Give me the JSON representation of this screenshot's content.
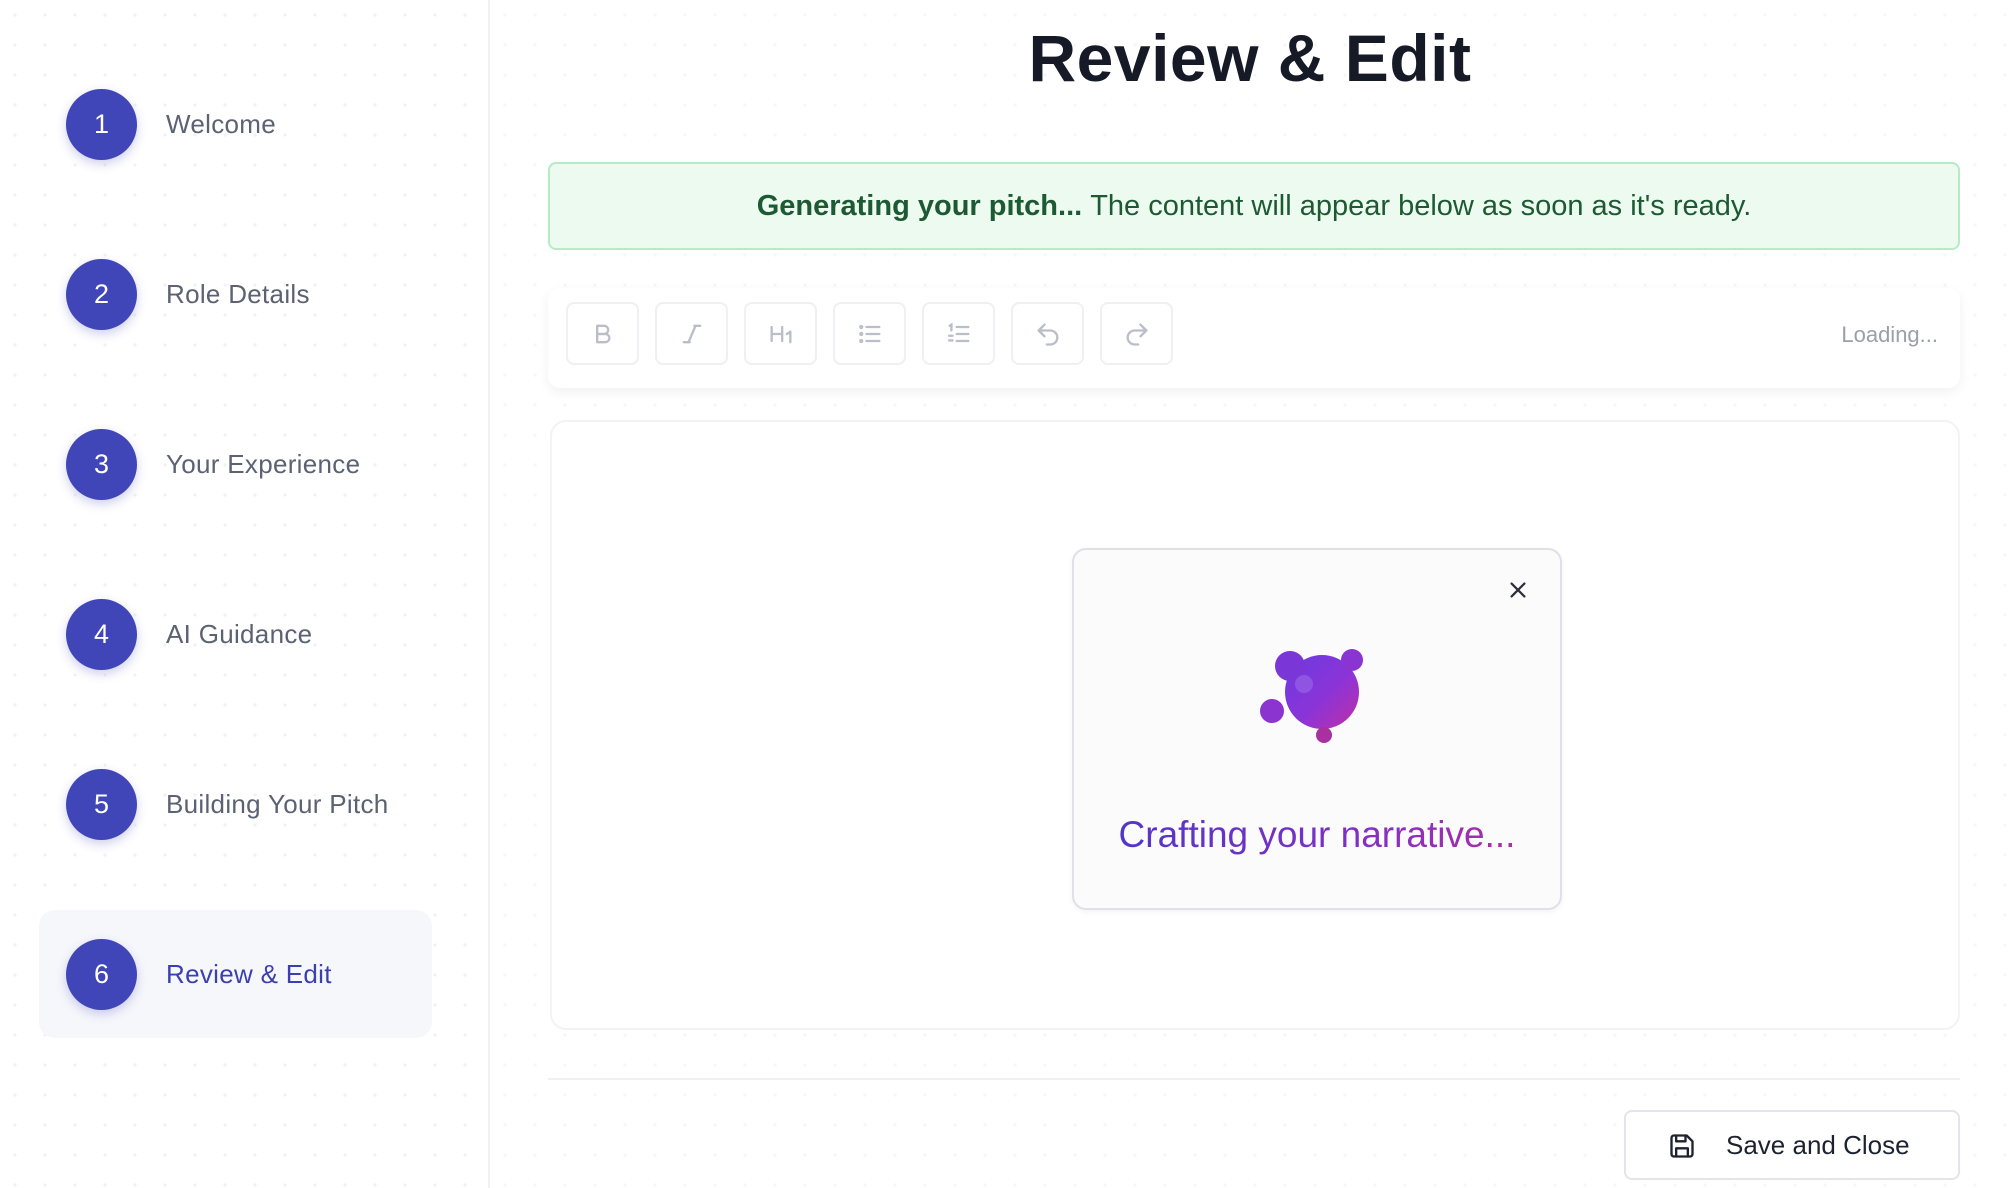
{
  "sidebar": {
    "steps": [
      {
        "number": "1",
        "label": "Welcome"
      },
      {
        "number": "2",
        "label": "Role Details"
      },
      {
        "number": "3",
        "label": "Your Experience"
      },
      {
        "number": "4",
        "label": "AI Guidance"
      },
      {
        "number": "5",
        "label": "Building Your Pitch"
      },
      {
        "number": "6",
        "label": "Review & Edit",
        "active": true
      }
    ]
  },
  "main": {
    "title": "Review & Edit",
    "banner": {
      "strong": "Generating your pitch...",
      "text": "The content will appear below as soon as it's ready."
    },
    "toolbar": {
      "buttons": [
        {
          "icon": "bold-icon",
          "label": "B"
        },
        {
          "icon": "italic-icon",
          "label": "I"
        },
        {
          "icon": "heading-1-icon",
          "label": "H1"
        },
        {
          "icon": "bullet-list-icon"
        },
        {
          "icon": "numbered-list-icon"
        },
        {
          "icon": "undo-icon"
        },
        {
          "icon": "redo-icon"
        }
      ],
      "status": "Loading..."
    },
    "loading_modal": {
      "message": "Crafting your narrative...",
      "close_icon": "close-icon",
      "graphic_icon": "blob-loader-icon"
    },
    "footer": {
      "save_label": "Save and Close",
      "save_icon": "save-icon"
    }
  },
  "colors": {
    "accent": "#4045b7",
    "banner_bg": "#ecfaf0",
    "banner_text": "#1d5a33",
    "gradient_start": "#4a37c4",
    "gradient_end": "#b62d9e"
  }
}
